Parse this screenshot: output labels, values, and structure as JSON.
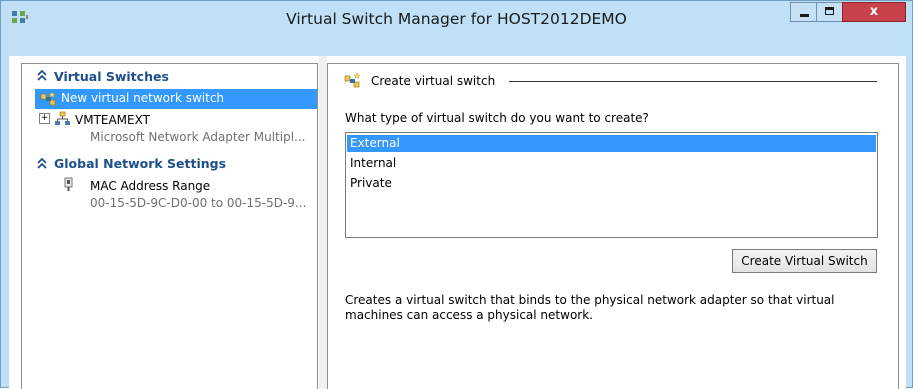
{
  "window": {
    "title": "Virtual Switch Manager for HOST2012DEMO",
    "close_glyph": "x"
  },
  "left_panel": {
    "sections": [
      {
        "label": "Virtual Switches",
        "items": [
          {
            "label": "New virtual network switch",
            "selected": true,
            "icon": "new-switch-icon"
          },
          {
            "label": "VMTEAMEXT",
            "sublabel": "Microsoft Network Adapter Multipl...",
            "icon": "network-switch-icon",
            "expander": "+"
          }
        ]
      },
      {
        "label": "Global Network Settings",
        "items": [
          {
            "label": "MAC Address Range",
            "sublabel": "00-15-5D-9C-D0-00 to 00-15-5D-9...",
            "icon": "mac-address-icon"
          }
        ]
      }
    ]
  },
  "right_panel": {
    "group_title": "Create virtual switch",
    "question": "What type of virtual switch do you want to create?",
    "options": [
      "External",
      "Internal",
      "Private"
    ],
    "selected_option": "External",
    "create_button": "Create Virtual Switch",
    "description": "Creates a virtual switch that binds to the physical network adapter so that virtual machines can access a physical network."
  },
  "colors": {
    "titlebar": "#bfe0f6",
    "selection": "#3399ff",
    "section_header": "#1e4f8c",
    "close_button": "#c7424a"
  }
}
